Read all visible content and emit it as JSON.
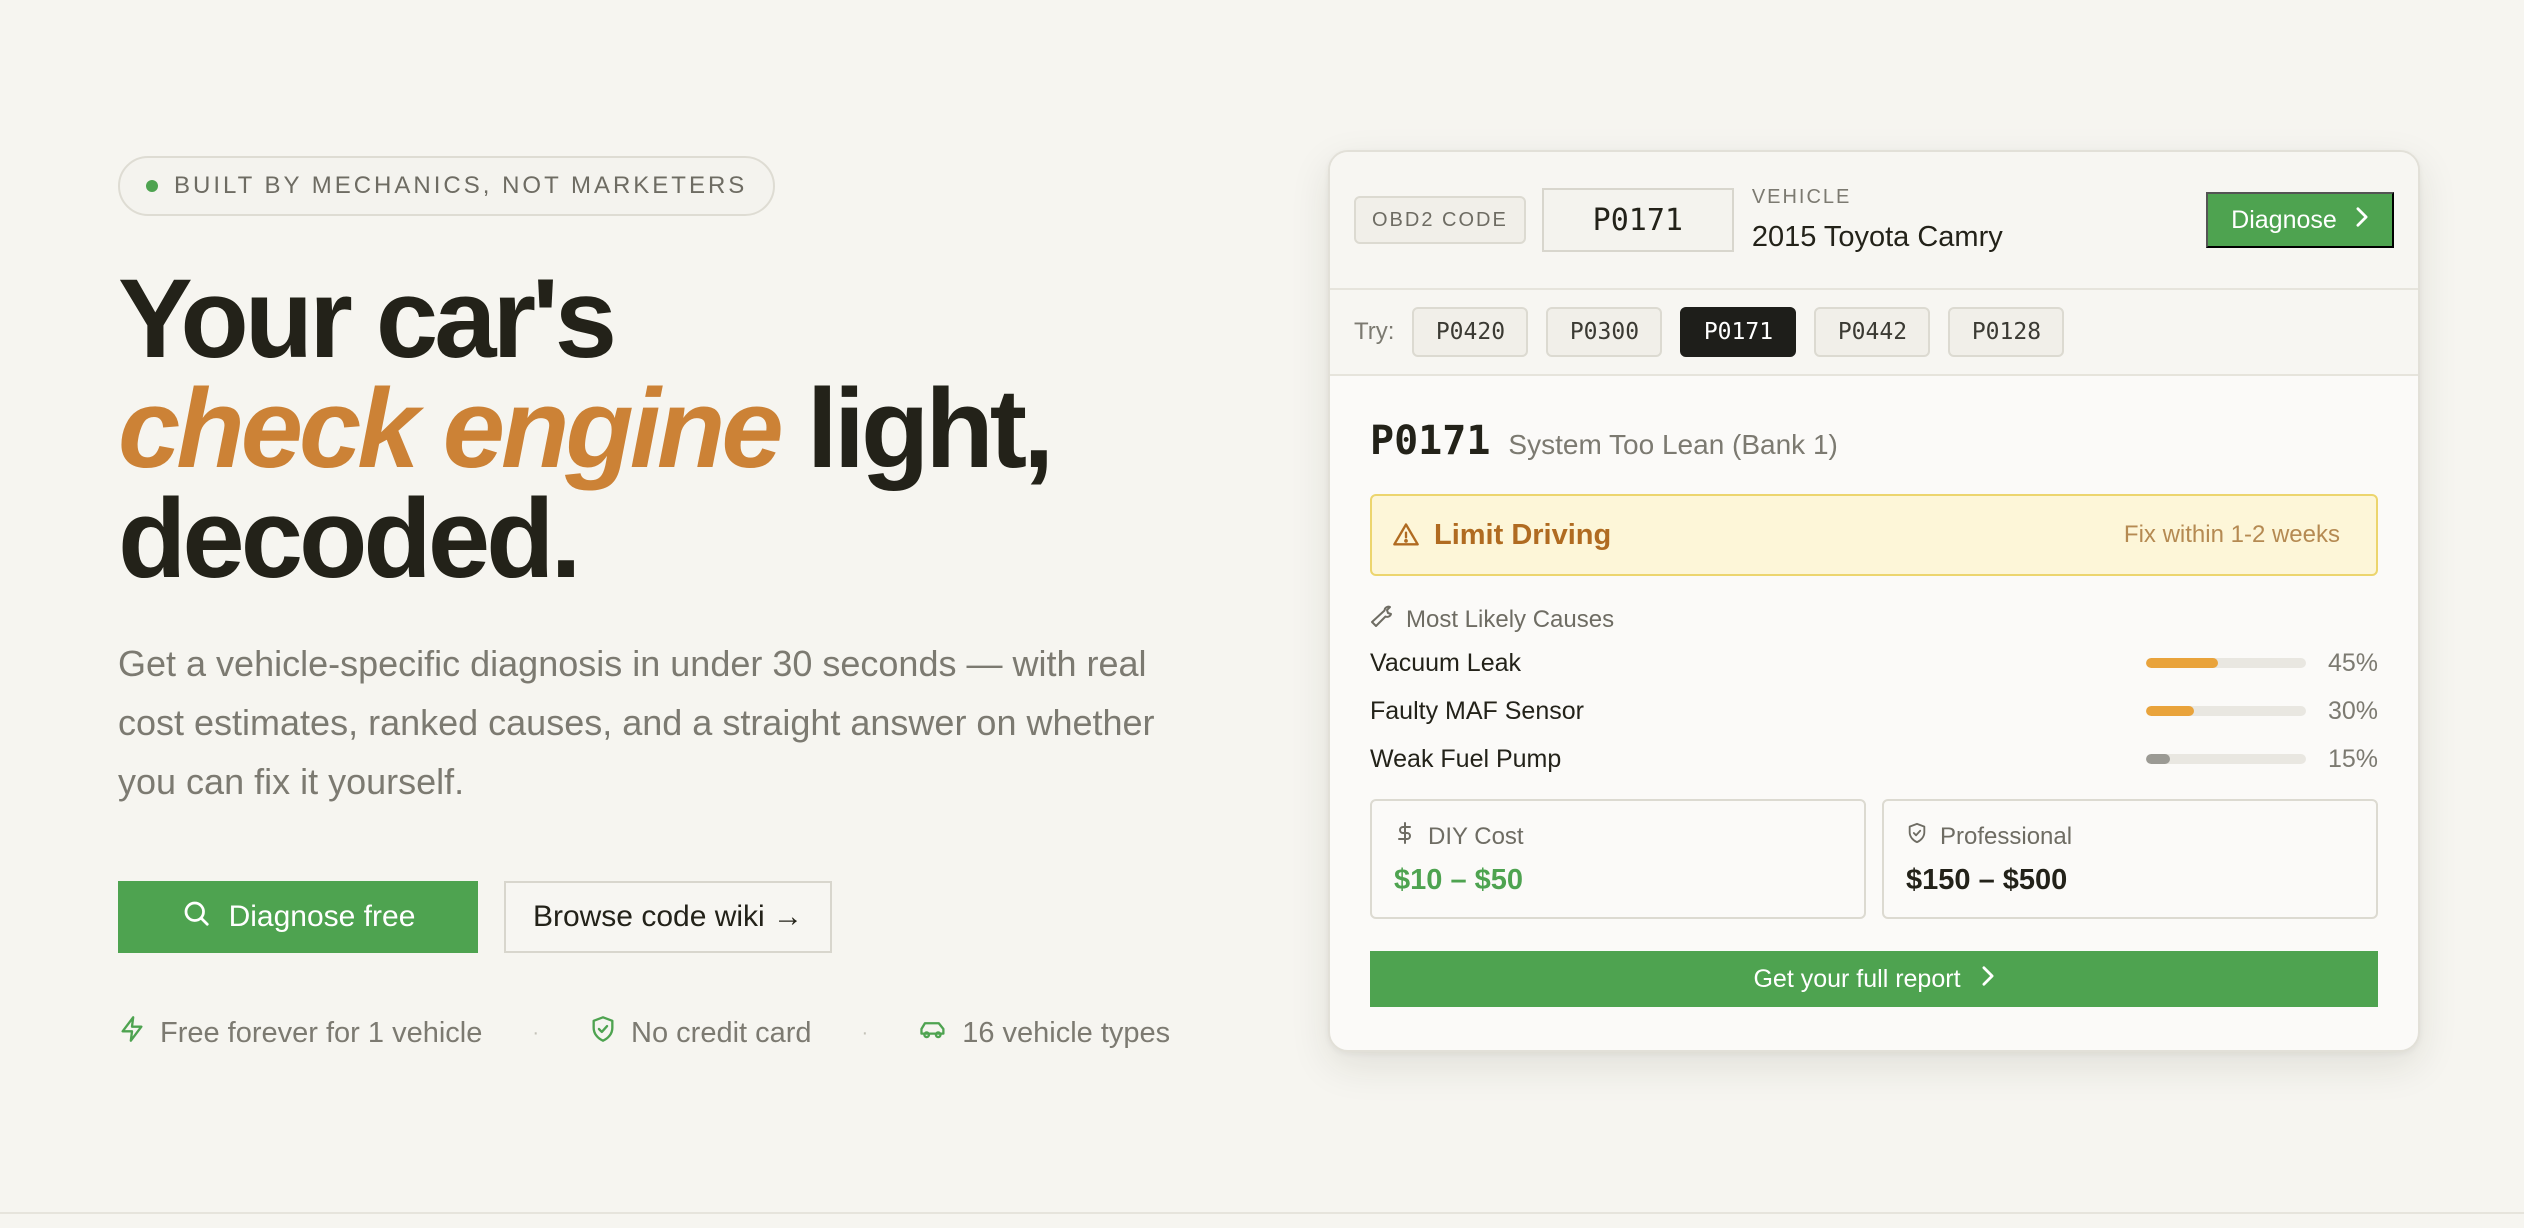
{
  "hero": {
    "badge": "BUILT BY MECHANICS, NOT MARKETERS",
    "headline_line1": "Your car's",
    "headline_accent": "check engine",
    "headline_line2_rest": " light,",
    "headline_line3": "decoded.",
    "subcopy": "Get a vehicle-specific diagnosis in under 30 seconds — with real cost estimates, ranked causes, and a straight answer on whether you can fix it yourself.",
    "primary_cta": "Diagnose free",
    "secondary_cta": "Browse code wiki →",
    "perks": [
      "Free forever for 1 vehicle",
      "No credit card",
      "16 vehicle types"
    ]
  },
  "card": {
    "obd_label": "OBD2 CODE",
    "code_value": "P0171",
    "vehicle_label": "VEHICLE",
    "vehicle_name": "2015 Toyota Camry",
    "diagnose_button": "Diagnose",
    "try_label": "Try:",
    "example_codes": [
      "P0420",
      "P0300",
      "P0171",
      "P0442",
      "P0128"
    ],
    "active_code": "P0171",
    "result": {
      "code": "P0171",
      "title": "System Too Lean (Bank 1)",
      "severity": "Limit Driving",
      "timeline": "Fix within 1-2 weeks",
      "causes_heading": "Most Likely Causes",
      "causes": [
        {
          "name": "Vacuum Leak",
          "pct_label": "45%",
          "pct": 0.45,
          "color": "#e9a33b"
        },
        {
          "name": "Faulty MAF Sensor",
          "pct_label": "30%",
          "pct": 0.3,
          "color": "#e9a33b"
        },
        {
          "name": "Weak Fuel Pump",
          "pct_label": "15%",
          "pct": 0.15,
          "color": "#9b9a94"
        }
      ],
      "diy_label": "DIY Cost",
      "diy_value": "$10 – $50",
      "pro_label": "Professional",
      "pro_value": "$150 – $500",
      "report_button": "Get your full report"
    }
  },
  "colors": {
    "brand_green": "#4ea350",
    "accent_orange": "#cc8236",
    "warning_text": "#b06b21",
    "warning_bg": "#fdf6d8"
  },
  "icons": [
    "dot-icon",
    "search-icon",
    "bolt-icon",
    "shield-check-icon",
    "car-icon",
    "chevron-right-icon",
    "warning-triangle-icon",
    "wrench-icon",
    "dollar-icon",
    "shield-icon"
  ]
}
